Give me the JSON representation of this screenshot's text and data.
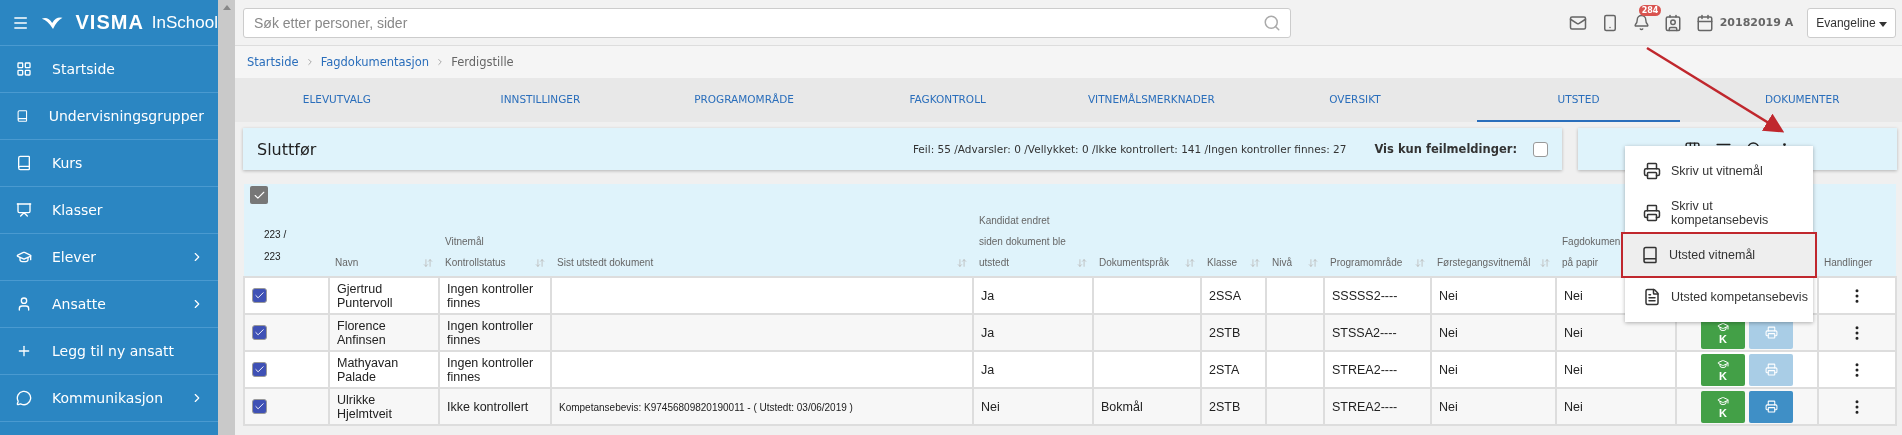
{
  "logo": {
    "brand": "VISMA",
    "product": "InSchool"
  },
  "sidebar": {
    "items": [
      {
        "label": "Startside",
        "has_submenu": false
      },
      {
        "label": "Undervisningsgrupper",
        "has_submenu": false
      },
      {
        "label": "Kurs",
        "has_submenu": false
      },
      {
        "label": "Klasser",
        "has_submenu": false
      },
      {
        "label": "Elever",
        "has_submenu": true
      },
      {
        "label": "Ansatte",
        "has_submenu": true
      },
      {
        "label": "Legg til ny ansatt",
        "has_submenu": false
      },
      {
        "label": "Kommunikasjon",
        "has_submenu": true
      }
    ]
  },
  "search": {
    "placeholder": "Søk etter personer, sider"
  },
  "topbar": {
    "notification_count": "284",
    "school_year": "20182019 A",
    "user_button": "Evangeline"
  },
  "breadcrumb": [
    "Startside",
    "Fagdokumentasjon",
    "Ferdigstille"
  ],
  "tabs": [
    {
      "label": "ELEVUTVALG",
      "selected": false
    },
    {
      "label": "INNSTILLINGER",
      "selected": false
    },
    {
      "label": "PROGRAMOMRÅDE",
      "selected": false
    },
    {
      "label": "FAGKONTROLL",
      "selected": false
    },
    {
      "label": "VITNEMÅLSMERKNADER",
      "selected": false
    },
    {
      "label": "OVERSIKT",
      "selected": false
    },
    {
      "label": "UTSTED",
      "selected": true
    },
    {
      "label": "DOKUMENTER",
      "selected": false
    }
  ],
  "panel": {
    "title": "Sluttfør",
    "summary": "Feil: 55 /Advarsler: 0 /Vellykket: 0 /Ikke kontrollert: 141 /Ingen kontroller finnes: 27",
    "filter_label": "Vis kun feilmeldinger:",
    "filter_checked": false
  },
  "table": {
    "select_all_checked": true,
    "count_lines": [
      "223 /",
      "223"
    ],
    "columns": [
      {
        "lines": [
          "Navn"
        ],
        "sortable": true
      },
      {
        "lines": [
          "Vitnemål",
          "Kontrollstatus"
        ],
        "sortable": true
      },
      {
        "lines": [
          "Sist utstedt dokument"
        ],
        "sortable": true
      },
      {
        "lines": [
          "Kandidat endret",
          "siden dokument ble",
          "utstedt"
        ],
        "sortable": true
      },
      {
        "lines": [
          "Dokumentspråk"
        ],
        "sortable": true
      },
      {
        "lines": [
          "Klasse"
        ],
        "sortable": true
      },
      {
        "lines": [
          "Nivå"
        ],
        "sortable": true
      },
      {
        "lines": [
          "Programområde"
        ],
        "sortable": true
      },
      {
        "lines": [
          "Førstegangsvitnemål"
        ],
        "sortable": true
      },
      {
        "lines": [
          "Fagdokumen",
          "på papir"
        ]
      },
      {},
      {
        "lines": [
          "Handlinger"
        ]
      }
    ],
    "rows": [
      {
        "checked": true,
        "cells": [
          "Gjertrud Puntervoll",
          "Ingen kontroller finnes",
          "",
          "Ja",
          "",
          "2SSA",
          "",
          "SSSSS2----",
          "Nei",
          "Nei"
        ]
      },
      {
        "checked": true,
        "cells": [
          "Florence Anfinsen",
          "Ingen kontroller finnes",
          "",
          "Ja",
          "",
          "2STB",
          "",
          "STSSA2----",
          "Nei",
          "Nei"
        ],
        "actions": {
          "k_label": "K",
          "print_enabled": false
        }
      },
      {
        "checked": true,
        "cells": [
          "Mathyavan Palade",
          "Ingen kontroller finnes",
          "",
          "Ja",
          "",
          "2STA",
          "",
          "STREA2----",
          "Nei",
          "Nei"
        ],
        "actions": {
          "k_label": "K",
          "print_enabled": false
        }
      },
      {
        "checked": true,
        "cells": [
          "Ulrikke Hjelmtveit",
          "Ikke kontrollert",
          "Kompetansebevis: K97456809820190011 - ( Utstedt: 03/06/2019 )",
          "Nei",
          "Bokmål",
          "2STB",
          "",
          "STREA2----",
          "Nei",
          "Nei"
        ],
        "actions": {
          "k_label": "K",
          "print_enabled": true
        }
      }
    ]
  },
  "menu": {
    "items": [
      {
        "label": "Skriv ut vitnemål",
        "selected": false
      },
      {
        "label": "Skriv ut kompetansebevis",
        "selected": false
      },
      {
        "label": "Utsted vitnemål",
        "selected": true
      },
      {
        "label": "Utsted kompetansebevis",
        "selected": false
      }
    ]
  }
}
